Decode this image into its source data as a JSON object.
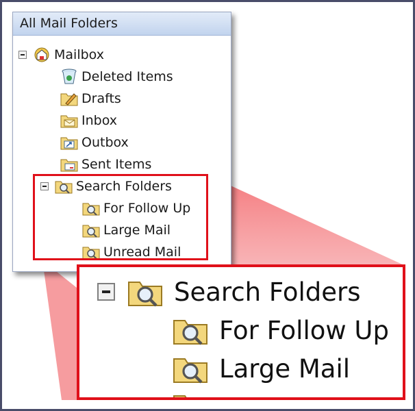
{
  "pane": {
    "header": "All Mail Folders",
    "root": "Mailbox",
    "folders": [
      "Deleted Items",
      "Drafts",
      "Inbox",
      "Outbox",
      "Sent Items"
    ],
    "search_group": "Search Folders",
    "search_folders": [
      "For Follow Up",
      "Large Mail",
      "Unread Mail"
    ]
  },
  "zoom": {
    "group": "Search Folders",
    "items": [
      "For Follow Up",
      "Large Mail"
    ]
  },
  "colors": {
    "callout": "#e0101a",
    "header": "#c2d4ee",
    "frame": "#4a4d6a"
  }
}
